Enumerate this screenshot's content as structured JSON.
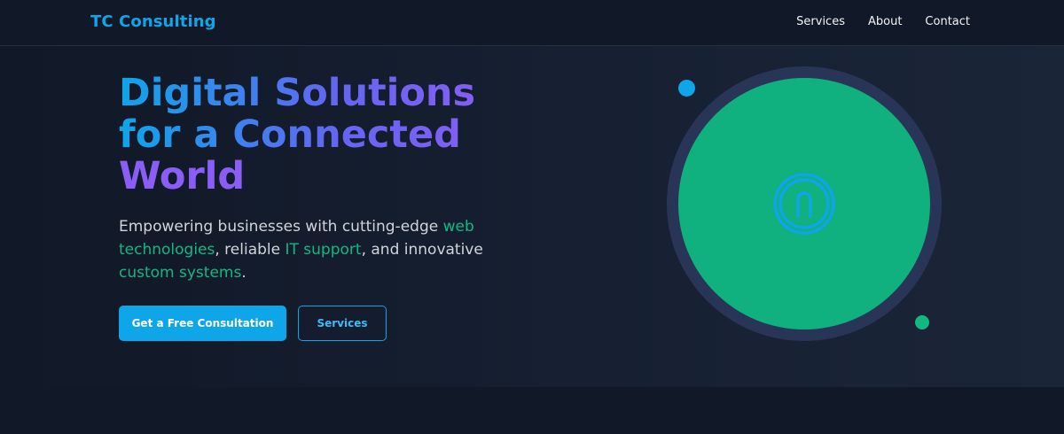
{
  "nav": {
    "brand": "TC Consulting",
    "links": [
      "Services",
      "About",
      "Contact"
    ]
  },
  "hero": {
    "headline_lines": [
      "Digital Solutions",
      "for a Connected",
      "World"
    ],
    "subtitle": {
      "p1": "Empowering businesses with cutting-edge ",
      "h1": "web technologies",
      "p2": ", reliable ",
      "h2": "IT support",
      "p3": ", and innovative ",
      "h3": "custom systems",
      "p4": "."
    },
    "primary_button": "Get a Free Consultation",
    "secondary_button": "Services"
  },
  "icons": {
    "emblem": "connected-arch-emblem-icon",
    "dot_blue": "decorative-dot",
    "dot_green": "decorative-dot"
  },
  "colors": {
    "background": "#111827",
    "accent_blue": "#0ea5e9",
    "accent_green": "#10b981",
    "accent_purple": "#8b5cf6",
    "disc_green": "#10b07f",
    "ring": "#283556"
  }
}
